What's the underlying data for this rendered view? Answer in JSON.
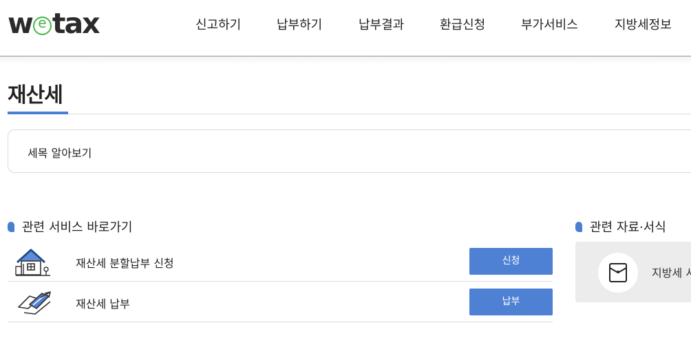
{
  "header": {
    "logo_text_pre": "w",
    "logo_text_mid": "e",
    "logo_text_post": "tax",
    "nav": [
      "신고하기",
      "납부하기",
      "납부결과",
      "환급신청",
      "부가서비스",
      "지방세정보"
    ]
  },
  "page": {
    "title": "재산세",
    "tax_info_label": "세목 알아보기"
  },
  "services": {
    "heading": "관련 서비스 바로가기",
    "items": [
      {
        "label": "재산세 분할납부 신청",
        "button": "신청",
        "icon": "house-icon"
      },
      {
        "label": "재산세 납부",
        "button": "납부",
        "icon": "card-payment-icon"
      }
    ]
  },
  "docs": {
    "heading": "관련 자료·서식",
    "item_label": "지방세 서",
    "icon": "envelope-document-icon"
  },
  "colors": {
    "accent": "#4e80d3",
    "logo_green": "#46b549"
  }
}
